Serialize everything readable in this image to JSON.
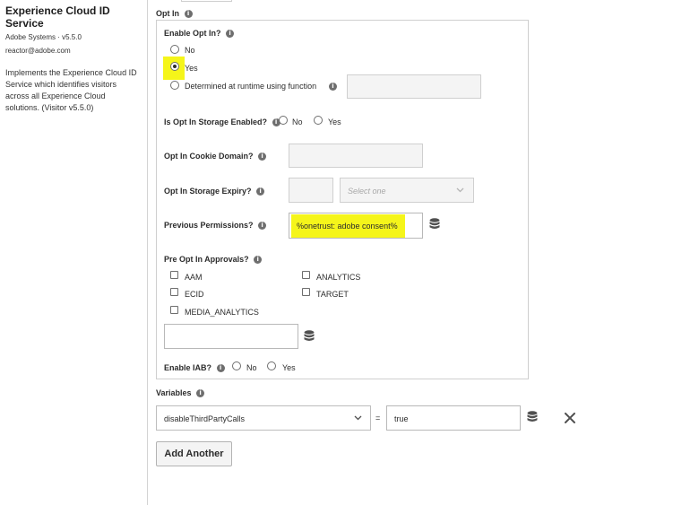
{
  "sidebar": {
    "extension_name": "Experience Cloud ID Service",
    "vendor": "Adobe Systems · v5.5.0",
    "email": "reactor@adobe.com",
    "description": "Implements the Experience Cloud ID Service which identifies visitors across all Experience Cloud solutions. (Visitor v5.5.0)"
  },
  "opt_in": {
    "section_label": "Opt In",
    "enable_label": "Enable Opt In?",
    "enable_options": [
      "No",
      "Yes",
      "Determined at runtime using function"
    ],
    "enable_selected": "Yes",
    "storage_enabled_label": "Is Opt In Storage Enabled?",
    "storage_enabled_options": [
      "No",
      "Yes"
    ],
    "cookie_domain_label": "Opt In Cookie Domain?",
    "storage_expiry_label": "Opt In Storage Expiry?",
    "storage_expiry_unit_placeholder": "Select one",
    "previous_permissions_label": "Previous Permissions?",
    "previous_permissions_value": "%onetrust: adobe consent%",
    "pre_approvals_label": "Pre Opt In Approvals?",
    "pre_approvals": [
      "AAM",
      "ANALYTICS",
      "ECID",
      "TARGET",
      "MEDIA_ANALYTICS"
    ],
    "enable_iab_label": "Enable IAB?",
    "enable_iab_options": [
      "No",
      "Yes"
    ]
  },
  "variables": {
    "section_label": "Variables",
    "name": "disableThirdPartyCalls",
    "equals": "=",
    "value": "true",
    "add_button": "Add Another"
  },
  "colors": {
    "highlight": "#f5f51a",
    "border": "#cfcfcf",
    "text": "#2c2c2c"
  }
}
